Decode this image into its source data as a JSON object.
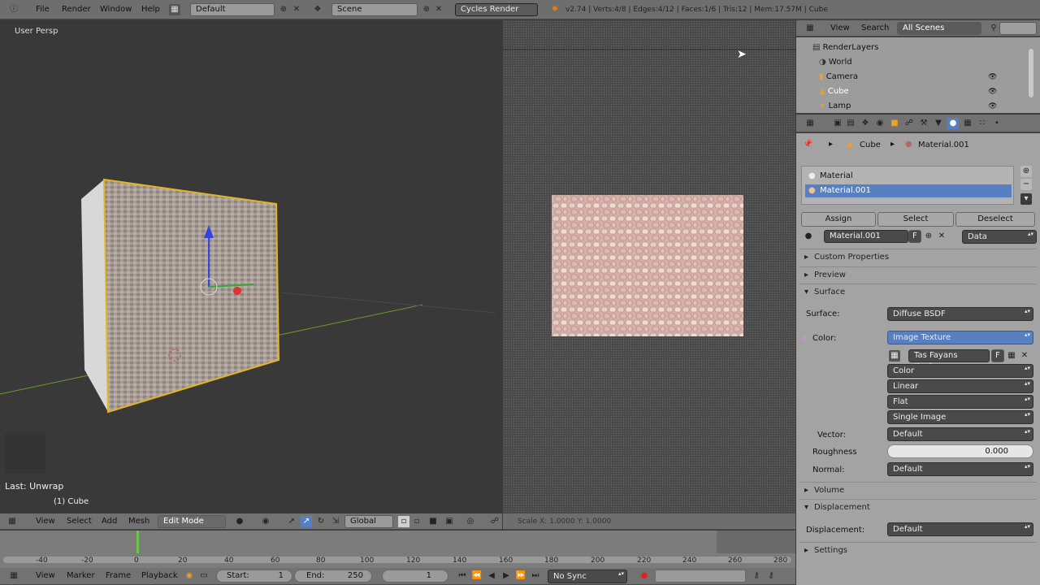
{
  "topbar": {
    "menus": [
      "File",
      "Render",
      "Window",
      "Help"
    ],
    "screen_layout": "Default",
    "scene": "Scene",
    "render_engine": "Cycles Render",
    "stats": "v2.74 | Verts:4/8 | Edges:4/12 | Faces:1/6 | Tris:12 | Mem:17.57M | Cube"
  },
  "viewport3d": {
    "view_label": "User Persp",
    "last_op": "Last: Unwrap",
    "object_label": "(1) Cube",
    "header": {
      "menus": [
        "View",
        "Select",
        "Add",
        "Mesh"
      ],
      "mode": "Edit Mode",
      "orientation": "Global"
    }
  },
  "uv_editor": {
    "status": "Scale X: 1.0000  Y: 1.0000"
  },
  "outliner": {
    "menus": [
      "View",
      "Search"
    ],
    "scope": "All Scenes",
    "items": [
      {
        "label": "RenderLayers"
      },
      {
        "label": "World"
      },
      {
        "label": "Camera"
      },
      {
        "label": "Cube"
      },
      {
        "label": "Lamp"
      }
    ]
  },
  "properties": {
    "breadcrumb_object": "Cube",
    "breadcrumb_material": "Material.001",
    "slots": [
      "Material",
      "Material.001"
    ],
    "assign_label": "Assign",
    "select_label": "Select",
    "deselect_label": "Deselect",
    "material_name": "Material.001",
    "fake_user": "F",
    "link": "Data",
    "panels": {
      "custom_props": "Custom Properties",
      "preview": "Preview",
      "surface": "Surface",
      "volume": "Volume",
      "displacement": "Displacement",
      "settings": "Settings"
    },
    "surface_label": "Surface:",
    "surface_value": "Diffuse BSDF",
    "color_label": "Color:",
    "color_value": "Image Texture",
    "image_name": "Tas Fayans Kapla...",
    "image_fake": "F",
    "color_space": "Color",
    "interpolation": "Linear",
    "projection": "Flat",
    "source": "Single Image",
    "vector_label": "Vector:",
    "vector_value": "Default",
    "roughness_label": "Roughness",
    "roughness_value": "0.000",
    "normal_label": "Normal:",
    "normal_value": "Default",
    "displacement_label": "Displacement:",
    "displacement_value": "Default"
  },
  "timeline": {
    "ticks": [
      "-40",
      "-20",
      "0",
      "20",
      "40",
      "60",
      "80",
      "100",
      "120",
      "140",
      "160",
      "180",
      "200",
      "220",
      "240",
      "260",
      "280"
    ],
    "menus": [
      "View",
      "Marker",
      "Frame",
      "Playback"
    ],
    "start_label": "Start:",
    "start_value": "1",
    "end_label": "End:",
    "end_value": "250",
    "current_frame": "1",
    "sync": "No Sync"
  },
  "colors": {
    "selection_blue": "#5680c2",
    "accent_orange": "#e8a030",
    "header_gray": "#727272",
    "panel_gray": "#a3a3a3"
  }
}
